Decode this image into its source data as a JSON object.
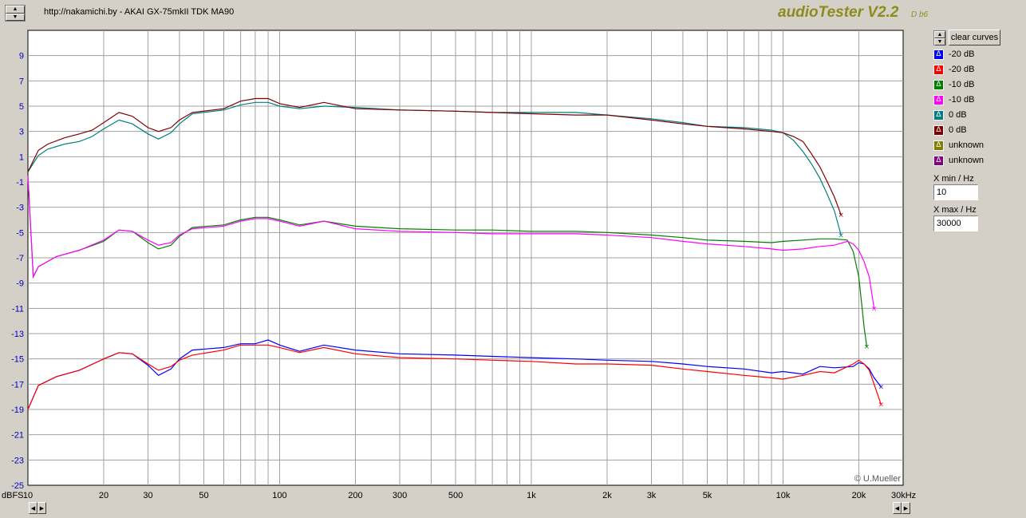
{
  "window": {
    "title": "http://nakamichi.by - AKAI GX-75mkII TDK MA90",
    "brand": "audioTester V2.2",
    "brand_sub": "D b6",
    "copyright": "© U.Mueller",
    "y_unit": "dBFS",
    "x_unit": "30kHz"
  },
  "side_panel": {
    "clear_label": "clear curves",
    "legend": [
      {
        "label": "-20 dB",
        "color": "#0000ff"
      },
      {
        "label": "-20 dB",
        "color": "#ff0000"
      },
      {
        "label": "-10 dB",
        "color": "#008000"
      },
      {
        "label": "-10 dB",
        "color": "#ff00ff"
      },
      {
        "label": "0 dB",
        "color": "#008080"
      },
      {
        "label": "0 dB",
        "color": "#800000"
      },
      {
        "label": "unknown",
        "color": "#808000"
      },
      {
        "label": "unknown",
        "color": "#800080"
      }
    ],
    "xmin_label": "X min / Hz",
    "xmin_value": "10",
    "xmax_label": "X max / Hz",
    "xmax_value": "30000"
  },
  "chart_data": {
    "type": "line",
    "xscale": "log",
    "xlim": [
      10,
      30000
    ],
    "ylim": [
      -25,
      11
    ],
    "grid": true,
    "title": "http://nakamichi.by - AKAI GX-75mkII TDK MA90",
    "xlabel": "",
    "ylabel": "dBFS",
    "y_ticks": [
      9,
      7,
      5,
      3,
      1,
      -1,
      -3,
      -5,
      -7,
      -9,
      -11,
      -13,
      -15,
      -17,
      -19,
      -21,
      -23,
      -25
    ],
    "x_tick_labels": [
      {
        "v": 20,
        "t": "20"
      },
      {
        "v": 30,
        "t": "30"
      },
      {
        "v": 50,
        "t": "50"
      },
      {
        "v": 100,
        "t": "100"
      },
      {
        "v": 200,
        "t": "200"
      },
      {
        "v": 300,
        "t": "300"
      },
      {
        "v": 500,
        "t": "500"
      },
      {
        "v": 1000,
        "t": "1k"
      },
      {
        "v": 2000,
        "t": "2k"
      },
      {
        "v": 3000,
        "t": "3k"
      },
      {
        "v": 5000,
        "t": "5k"
      },
      {
        "v": 10000,
        "t": "10k"
      },
      {
        "v": 20000,
        "t": "20k"
      }
    ],
    "x_origin_label": "10",
    "series": [
      {
        "name": "-20 dB",
        "color": "#0000ff",
        "points": [
          [
            10,
            -19
          ],
          [
            11,
            -17.1
          ],
          [
            13,
            -16.4
          ],
          [
            16,
            -15.9
          ],
          [
            20,
            -15
          ],
          [
            23,
            -14.5
          ],
          [
            26,
            -14.6
          ],
          [
            30,
            -15.5
          ],
          [
            33,
            -16.3
          ],
          [
            37,
            -15.8
          ],
          [
            40,
            -15
          ],
          [
            45,
            -14.3
          ],
          [
            60,
            -14.1
          ],
          [
            70,
            -13.8
          ],
          [
            80,
            -13.8
          ],
          [
            90,
            -13.5
          ],
          [
            100,
            -13.9
          ],
          [
            120,
            -14.4
          ],
          [
            150,
            -13.9
          ],
          [
            200,
            -14.3
          ],
          [
            300,
            -14.6
          ],
          [
            500,
            -14.7
          ],
          [
            700,
            -14.8
          ],
          [
            1000,
            -14.9
          ],
          [
            1500,
            -15
          ],
          [
            2000,
            -15.1
          ],
          [
            3000,
            -15.2
          ],
          [
            4000,
            -15.4
          ],
          [
            5000,
            -15.6
          ],
          [
            7000,
            -15.8
          ],
          [
            9000,
            -16.1
          ],
          [
            10000,
            -16
          ],
          [
            12000,
            -16.2
          ],
          [
            14000,
            -15.6
          ],
          [
            16000,
            -15.7
          ],
          [
            19000,
            -15.6
          ],
          [
            20000,
            -15.3
          ],
          [
            21000,
            -15.4
          ],
          [
            22000,
            -15.8
          ],
          [
            23000,
            -16.5
          ],
          [
            24500,
            -17.2
          ]
        ]
      },
      {
        "name": "-20 dB",
        "color": "#ff0000",
        "points": [
          [
            10,
            -19
          ],
          [
            11,
            -17.1
          ],
          [
            13,
            -16.4
          ],
          [
            16,
            -15.9
          ],
          [
            20,
            -15
          ],
          [
            23,
            -14.5
          ],
          [
            26,
            -14.6
          ],
          [
            30,
            -15.4
          ],
          [
            33,
            -15.9
          ],
          [
            37,
            -15.6
          ],
          [
            40,
            -15.1
          ],
          [
            45,
            -14.7
          ],
          [
            60,
            -14.3
          ],
          [
            70,
            -13.9
          ],
          [
            80,
            -13.9
          ],
          [
            90,
            -13.9
          ],
          [
            100,
            -14.1
          ],
          [
            120,
            -14.5
          ],
          [
            150,
            -14.1
          ],
          [
            200,
            -14.6
          ],
          [
            300,
            -14.9
          ],
          [
            500,
            -15
          ],
          [
            700,
            -15.1
          ],
          [
            1000,
            -15.2
          ],
          [
            1500,
            -15.4
          ],
          [
            2000,
            -15.4
          ],
          [
            3000,
            -15.5
          ],
          [
            4000,
            -15.8
          ],
          [
            5000,
            -16
          ],
          [
            7000,
            -16.3
          ],
          [
            9000,
            -16.5
          ],
          [
            10000,
            -16.6
          ],
          [
            12000,
            -16.3
          ],
          [
            14000,
            -16
          ],
          [
            16000,
            -16.1
          ],
          [
            19000,
            -15.4
          ],
          [
            20000,
            -15.1
          ],
          [
            21000,
            -15.4
          ],
          [
            22000,
            -15.9
          ],
          [
            23000,
            -17
          ],
          [
            24500,
            -18.6
          ]
        ]
      },
      {
        "name": "-10 dB",
        "color": "#008000",
        "points": [
          [
            10,
            -0.5
          ],
          [
            10.5,
            -8.5
          ],
          [
            11,
            -7.7
          ],
          [
            13,
            -6.9
          ],
          [
            16,
            -6.4
          ],
          [
            20,
            -5.7
          ],
          [
            23,
            -4.8
          ],
          [
            26,
            -4.9
          ],
          [
            30,
            -5.8
          ],
          [
            33,
            -6.3
          ],
          [
            37,
            -6
          ],
          [
            40,
            -5.3
          ],
          [
            45,
            -4.6
          ],
          [
            60,
            -4.4
          ],
          [
            70,
            -4
          ],
          [
            80,
            -3.8
          ],
          [
            90,
            -3.8
          ],
          [
            100,
            -4
          ],
          [
            120,
            -4.4
          ],
          [
            150,
            -4.1
          ],
          [
            200,
            -4.5
          ],
          [
            300,
            -4.7
          ],
          [
            500,
            -4.8
          ],
          [
            700,
            -4.8
          ],
          [
            1000,
            -4.9
          ],
          [
            1500,
            -4.9
          ],
          [
            2000,
            -5
          ],
          [
            3000,
            -5.2
          ],
          [
            4000,
            -5.4
          ],
          [
            5000,
            -5.6
          ],
          [
            7000,
            -5.7
          ],
          [
            9000,
            -5.8
          ],
          [
            10000,
            -5.7
          ],
          [
            12000,
            -5.6
          ],
          [
            14000,
            -5.5
          ],
          [
            16000,
            -5.5
          ],
          [
            18000,
            -5.6
          ],
          [
            19000,
            -6.5
          ],
          [
            20000,
            -8.5
          ],
          [
            20500,
            -10.5
          ],
          [
            21000,
            -12.5
          ],
          [
            21500,
            -14
          ]
        ]
      },
      {
        "name": "-10 dB",
        "color": "#ff00ff",
        "points": [
          [
            10,
            -0.5
          ],
          [
            10.5,
            -8.5
          ],
          [
            11,
            -7.7
          ],
          [
            13,
            -6.9
          ],
          [
            16,
            -6.4
          ],
          [
            20,
            -5.6
          ],
          [
            23,
            -4.8
          ],
          [
            26,
            -4.9
          ],
          [
            30,
            -5.6
          ],
          [
            33,
            -6
          ],
          [
            37,
            -5.8
          ],
          [
            40,
            -5.2
          ],
          [
            45,
            -4.7
          ],
          [
            60,
            -4.5
          ],
          [
            70,
            -4.1
          ],
          [
            80,
            -3.9
          ],
          [
            90,
            -3.9
          ],
          [
            100,
            -4.1
          ],
          [
            120,
            -4.5
          ],
          [
            150,
            -4.1
          ],
          [
            200,
            -4.7
          ],
          [
            300,
            -4.9
          ],
          [
            500,
            -5
          ],
          [
            700,
            -5.1
          ],
          [
            1000,
            -5.1
          ],
          [
            1500,
            -5.1
          ],
          [
            2000,
            -5.2
          ],
          [
            3000,
            -5.4
          ],
          [
            4000,
            -5.7
          ],
          [
            5000,
            -5.9
          ],
          [
            7000,
            -6.1
          ],
          [
            9000,
            -6.3
          ],
          [
            10000,
            -6.4
          ],
          [
            12000,
            -6.3
          ],
          [
            14000,
            -6.1
          ],
          [
            16000,
            -6
          ],
          [
            18000,
            -5.7
          ],
          [
            19000,
            -5.9
          ],
          [
            20000,
            -6.4
          ],
          [
            21000,
            -7.3
          ],
          [
            22000,
            -8.5
          ],
          [
            23000,
            -11
          ]
        ]
      },
      {
        "name": "0 dB",
        "color": "#008080",
        "points": [
          [
            10,
            -0.2
          ],
          [
            11,
            1.1
          ],
          [
            12,
            1.6
          ],
          [
            14,
            2
          ],
          [
            16,
            2.2
          ],
          [
            18,
            2.6
          ],
          [
            20,
            3.2
          ],
          [
            23,
            3.9
          ],
          [
            26,
            3.6
          ],
          [
            30,
            2.8
          ],
          [
            33,
            2.4
          ],
          [
            37,
            2.9
          ],
          [
            40,
            3.6
          ],
          [
            45,
            4.4
          ],
          [
            60,
            4.7
          ],
          [
            70,
            5.1
          ],
          [
            80,
            5.3
          ],
          [
            90,
            5.3
          ],
          [
            100,
            5
          ],
          [
            120,
            4.8
          ],
          [
            150,
            5
          ],
          [
            200,
            4.9
          ],
          [
            300,
            4.7
          ],
          [
            500,
            4.6
          ],
          [
            700,
            4.5
          ],
          [
            1000,
            4.5
          ],
          [
            1500,
            4.5
          ],
          [
            2000,
            4.3
          ],
          [
            3000,
            4
          ],
          [
            4000,
            3.7
          ],
          [
            5000,
            3.4
          ],
          [
            7000,
            3.3
          ],
          [
            9000,
            3.1
          ],
          [
            10000,
            2.9
          ],
          [
            11000,
            2.3
          ],
          [
            12000,
            1.4
          ],
          [
            13000,
            0.4
          ],
          [
            14000,
            -0.7
          ],
          [
            15000,
            -2
          ],
          [
            16000,
            -3.3
          ],
          [
            17000,
            -5.2
          ]
        ]
      },
      {
        "name": "0 dB",
        "color": "#800000",
        "points": [
          [
            10,
            -0.2
          ],
          [
            11,
            1.5
          ],
          [
            12,
            2
          ],
          [
            14,
            2.5
          ],
          [
            16,
            2.8
          ],
          [
            18,
            3.1
          ],
          [
            20,
            3.7
          ],
          [
            23,
            4.5
          ],
          [
            26,
            4.2
          ],
          [
            30,
            3.3
          ],
          [
            33,
            3
          ],
          [
            37,
            3.3
          ],
          [
            40,
            3.9
          ],
          [
            45,
            4.5
          ],
          [
            60,
            4.8
          ],
          [
            70,
            5.4
          ],
          [
            80,
            5.6
          ],
          [
            90,
            5.6
          ],
          [
            100,
            5.2
          ],
          [
            120,
            4.9
          ],
          [
            150,
            5.3
          ],
          [
            200,
            4.8
          ],
          [
            300,
            4.7
          ],
          [
            500,
            4.6
          ],
          [
            700,
            4.5
          ],
          [
            1000,
            4.4
          ],
          [
            1500,
            4.3
          ],
          [
            2000,
            4.3
          ],
          [
            3000,
            3.9
          ],
          [
            4000,
            3.6
          ],
          [
            5000,
            3.4
          ],
          [
            7000,
            3.2
          ],
          [
            9000,
            3
          ],
          [
            10000,
            2.9
          ],
          [
            11000,
            2.6
          ],
          [
            12000,
            2.2
          ],
          [
            13000,
            1.2
          ],
          [
            14000,
            0.2
          ],
          [
            15000,
            -1
          ],
          [
            16000,
            -2.2
          ],
          [
            17000,
            -3.6
          ]
        ]
      }
    ]
  }
}
